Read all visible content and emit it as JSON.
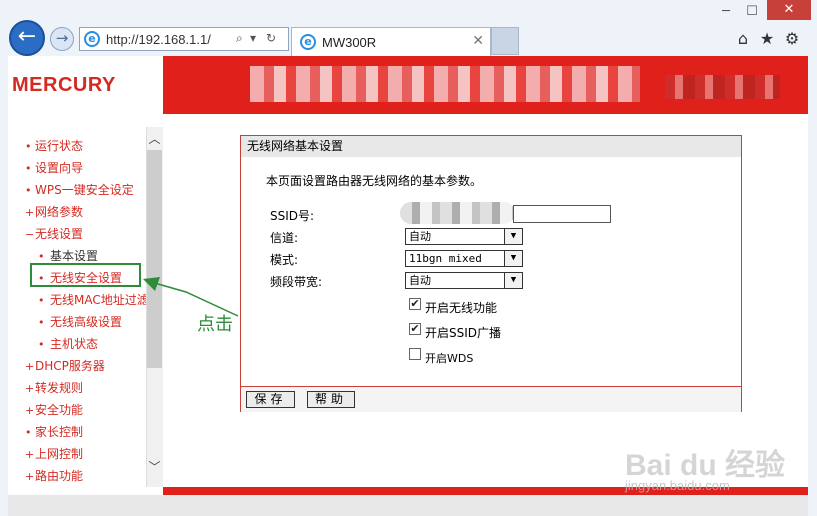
{
  "browser": {
    "address": "http://192.168.1.1/",
    "tab_title": "MW300R",
    "back_glyph": "←",
    "forward_glyph": "→",
    "search_glyph": "⌕",
    "refresh_glyph": "↻",
    "dropdown_glyph": "▾",
    "close_glyph": "✕",
    "minimize_glyph": "─",
    "maximize_glyph": "☐",
    "home_glyph": "⌂",
    "favorites_glyph": "★",
    "settings_glyph": "⚙"
  },
  "router": {
    "brand": "MERCURY",
    "brand_color": "#d42a22",
    "header_color": "#e0201b"
  },
  "sidebar": {
    "items": [
      {
        "label": "运行状态",
        "bullet": "•"
      },
      {
        "label": "设置向导",
        "bullet": "•"
      },
      {
        "label": "WPS一键安全设定",
        "bullet": "•"
      },
      {
        "label": "网络参数",
        "bullet": "+"
      },
      {
        "label": "无线设置",
        "bullet": "−"
      },
      {
        "label": "基本设置",
        "bullet": "•",
        "sub": true,
        "active": true
      },
      {
        "label": "无线安全设置",
        "bullet": "•",
        "sub": true,
        "highlighted": true
      },
      {
        "label": "无线MAC地址过滤",
        "bullet": "•",
        "sub": true
      },
      {
        "label": "无线高级设置",
        "bullet": "•",
        "sub": true
      },
      {
        "label": "主机状态",
        "bullet": "•",
        "sub": true
      },
      {
        "label": "DHCP服务器",
        "bullet": "+"
      },
      {
        "label": "转发规则",
        "bullet": "+"
      },
      {
        "label": "安全功能",
        "bullet": "+"
      },
      {
        "label": "家长控制",
        "bullet": "•"
      },
      {
        "label": "上网控制",
        "bullet": "+"
      },
      {
        "label": "路由功能",
        "bullet": "+"
      }
    ],
    "scroll_up": "︿",
    "scroll_down": "﹀"
  },
  "annotation": {
    "label": "点击",
    "color": "#2e8b3a"
  },
  "panel": {
    "title": "无线网络基本设置",
    "description": "本页面设置路由器无线网络的基本参数。",
    "ssid_label": "SSID号:",
    "channel_label": "信道:",
    "channel_value": "自动",
    "mode_label": "模式:",
    "mode_value": "11bgn mixed",
    "bandwidth_label": "频段带宽:",
    "bandwidth_value": "自动",
    "select_arrow": "▼",
    "enable_wireless": {
      "label": "开启无线功能",
      "checked": true
    },
    "enable_ssid_broadcast": {
      "label": "开启SSID广播",
      "checked": true
    },
    "enable_wds": {
      "label": "开启WDS",
      "checked": false
    },
    "check_glyph": "✔",
    "save_label": "保存",
    "help_label": "帮助"
  },
  "watermark": {
    "line1": "Bai du 经验",
    "line2": "jingyan.baidu.com"
  }
}
